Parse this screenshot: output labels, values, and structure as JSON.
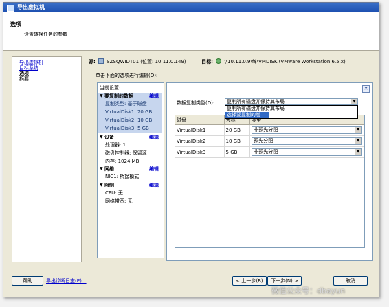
{
  "window": {
    "title": "导出虚拟机"
  },
  "header": {
    "title": "选项",
    "subtitle": "设置转换任务的参数"
  },
  "nav": {
    "items": [
      {
        "label": "导出虚拟机",
        "state": "link"
      },
      {
        "label": "目标系统",
        "state": "link"
      },
      {
        "label": "选项",
        "state": "current"
      },
      {
        "label": "摘要",
        "state": "plain"
      }
    ]
  },
  "source": {
    "label": "源:",
    "vm": "SZSQWIDT01",
    "location": "(位置: 10.11.0.149)",
    "target_label": "目标:",
    "target_value": "\\\\10.11.0.9\\f$\\VMDISK (VMware Workstation 6.5.x)"
  },
  "instruction": "单击下面的选项进行编辑(O):",
  "current_settings": {
    "title": "当前设置:",
    "edit_label": "编辑",
    "sections": [
      {
        "title": "要复制的数据",
        "selected": true,
        "rows": [
          "复制类型: 基于磁盘",
          "VirtualDisk1: 20 GB",
          "VirtualDisk2: 10 GB",
          "VirtualDisk3: 5 GB"
        ]
      },
      {
        "title": "设备",
        "selected": false,
        "rows": [
          "处理器: 1",
          "磁盘控制器: 保留源",
          "内存: 1024 MB"
        ]
      },
      {
        "title": "网络",
        "selected": false,
        "rows": [
          "NIC1: 桥接模式"
        ]
      },
      {
        "title": "限制",
        "selected": false,
        "rows": [
          "CPU: 无",
          "网络带宽: 无"
        ]
      }
    ]
  },
  "copy_type": {
    "label": "数据复制类型(D):",
    "value": "复制所有磁盘并保持其布局",
    "options": [
      "复制所有磁盘并保持其布局",
      "选择要复制的卷"
    ]
  },
  "disk_table": {
    "headers": [
      "磁盘",
      "大小",
      "类型"
    ],
    "rows": [
      {
        "disk": "VirtualDisk1",
        "size": "20 GB",
        "type": "非预先分配"
      },
      {
        "disk": "VirtualDisk2",
        "size": "10 GB",
        "type": "预先分配"
      },
      {
        "disk": "VirtualDisk3",
        "size": "5 GB",
        "type": "非预先分配"
      }
    ]
  },
  "footer": {
    "help": "帮助",
    "log_link": "导出诊断日志(E)...",
    "back": "< 上一步(B)",
    "next": "下一步(N) >",
    "cancel": "取消"
  },
  "watermark": "微信公众号：dbayun",
  "colors": {
    "title_bar": "#1c4fb0",
    "selection": "#316ac5",
    "link": "#0000cc",
    "section_highlight": "#c7d6ee"
  }
}
